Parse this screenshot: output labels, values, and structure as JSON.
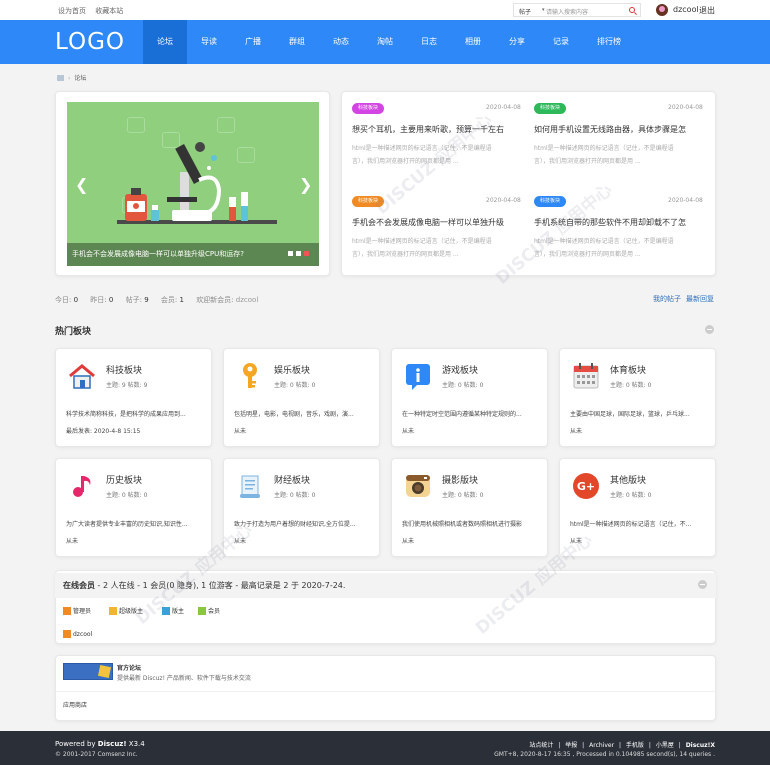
{
  "topbar": {
    "set_home": "设为首页",
    "bookmark": "收藏本站",
    "search_type": "帖子",
    "search_placeholder": "请输入搜索内容",
    "username": "dzcool",
    "logout": "退出"
  },
  "nav": {
    "logo": "LOGO",
    "items": [
      "论坛",
      "导读",
      "广播",
      "群组",
      "动态",
      "淘帖",
      "日志",
      "相册",
      "分享",
      "记录",
      "排行榜"
    ],
    "active": "论坛"
  },
  "breadcrumb": {
    "current": "论坛"
  },
  "slider": {
    "caption": "手机会不会发展成像电脑一样可以单独升级CPU和运存?"
  },
  "news": [
    {
      "tag": "科技板块",
      "tag_color": "#d245e2",
      "date": "2020-04-08",
      "title": "想买个耳机，主要用来听歌，预算一千左右",
      "desc_1": "html是一种描述网页的标记语言（记住，不是编程语",
      "desc_2": "言），我们用浏览器打开的网页都是用 ..."
    },
    {
      "tag": "科技板块",
      "tag_color": "#2fb85a",
      "date": "2020-04-08",
      "title": "如何用手机设置无线路由器，具体步骤是怎",
      "desc_1": "html是一种描述网页的标记语言（记住，不是编程语",
      "desc_2": "言），我们用浏览器打开的网页都是用 ..."
    },
    {
      "tag": "科技板块",
      "tag_color": "#f08a24",
      "date": "2020-04-08",
      "title": "手机会不会发展成像电脑一样可以单独升级",
      "desc_1": "html是一种描述网页的标记语言（记住，不是编程语",
      "desc_2": "言），我们用浏览器打开的网页都是用 ..."
    },
    {
      "tag": "科技板块",
      "tag_color": "#2f88f7",
      "date": "2020-04-08",
      "title": "手机系统自带的那些软件不用却卸载不了怎",
      "desc_1": "html是一种描述网页的标记语言（记住，不是编程语",
      "desc_2": "言），我们用浏览器打开的网页都是用 ..."
    }
  ],
  "stats": {
    "today_label": "今日:",
    "today": "0",
    "yesterday_label": "昨日:",
    "yesterday": "0",
    "posts_label": "帖子:",
    "posts": "9",
    "members_label": "会员:",
    "members": "1",
    "newest_label": "欢迎新会员:",
    "newest": "dzcool",
    "my_posts": "我的帖子",
    "latest_replies": "最新回复"
  },
  "hot": {
    "title": "热门板块"
  },
  "forums": [
    {
      "name": "科技板块",
      "stats": "主题: 9   帖数: 9",
      "desc": "科学技术简称科技，是把科学的成果应用到...",
      "last": "最后发表: 2020-4-8 15:15",
      "icon": "house-icon"
    },
    {
      "name": "娱乐板块",
      "stats": "主题: 0   帖数: 0",
      "desc": "包括明星，电影，电视剧，音乐，戏剧，演...",
      "last": "从未",
      "icon": "key-icon"
    },
    {
      "name": "游戏板块",
      "stats": "主题: 0   帖数: 0",
      "desc": "在一种特定时空范围内遵循某种特定规则的...",
      "last": "从未",
      "icon": "info-icon"
    },
    {
      "name": "体育板块",
      "stats": "主题: 0   帖数: 0",
      "desc": "主要由中国足球，国际足球，篮球，乒乓球...",
      "last": "从未",
      "icon": "calendar-icon"
    },
    {
      "name": "历史板块",
      "stats": "主题: 0   帖数: 0",
      "desc": "为广大读者提供专业丰富的历史知识,知识性...",
      "last": "从未",
      "icon": "music-note-icon"
    },
    {
      "name": "财经板块",
      "stats": "主题: 0   帖数: 0",
      "desc": "致力于打造为用户着想的财经知识,全方位提...",
      "last": "从未",
      "icon": "scroll-icon"
    },
    {
      "name": "摄影版块",
      "stats": "主题: 0   帖数: 0",
      "desc": "我们使用机械照相机或者数码照相机进行摄影",
      "last": "从未",
      "icon": "camera-icon"
    },
    {
      "name": "其他版块",
      "stats": "主题: 0   帖数: 0",
      "desc": "html是一种描述网页的标记语言（记住，不...",
      "last": "从未",
      "icon": "google-plus-icon"
    }
  ],
  "online": {
    "title": "在线会员",
    "detail": " - 2 人在线 - 1 会员(0 隐身), 1 位游客 - 最高记录是 2 于 2020-7-24.",
    "legend": [
      {
        "label": "管理员",
        "color": "#f08a24"
      },
      {
        "label": "超级版主",
        "color": "#f2b530"
      },
      {
        "label": "版主",
        "color": "#3aa0d8"
      },
      {
        "label": "会员",
        "color": "#8cc63f"
      }
    ],
    "user": "dzcool"
  },
  "links": {
    "title": "官方论坛",
    "desc": "提供最新 Discuz! 产品新闻、软件下载与技术交流",
    "more": "应用商店"
  },
  "footer": {
    "powered_pre": "Powered by ",
    "powered_name": "Discuz!",
    "powered_ver": " X3.4",
    "copyright": "© 2001-2017 Comsenz Inc.",
    "links": [
      "站点统计",
      "|",
      "举报",
      "|",
      "Archiver",
      "|",
      "手机版",
      "|",
      "小黑屋",
      "|",
      "Discuz!X"
    ],
    "time": "GMT+8, 2020-8-17 16:35 , Processed in 0.104985 second(s), 14 queries ."
  }
}
